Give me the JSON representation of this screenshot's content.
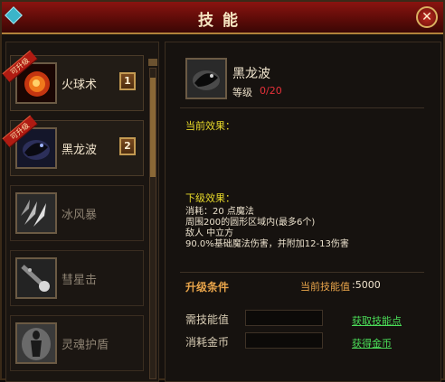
{
  "window": {
    "title": "技能"
  },
  "skills": [
    {
      "name": "火球术",
      "level": "1",
      "ribbon": "可升级"
    },
    {
      "name": "黑龙波",
      "level": "2",
      "ribbon": "可升级"
    },
    {
      "name": "冰风暴"
    },
    {
      "name": "彗星击"
    },
    {
      "name": "灵魂护盾"
    }
  ],
  "detail": {
    "name": "黑龙波",
    "level_label": "等级",
    "level_value": "0/20",
    "current_effect_title": "当前效果：",
    "next_effect_title": "下级效果：",
    "next_effect_lines": [
      "消耗：20 点魔法",
      "周围200的圆形区域内(最多6个)",
      "敌人 中立方",
      "90.0%基础魔法伤害，并附加12-13伤害"
    ],
    "upgrade_title": "升级条件",
    "current_points_label": "当前技能值",
    "current_points_value": ":5000",
    "required_points_label": "需技能值",
    "gold_cost_label": "消耗金币",
    "get_points_link": "获取技能点",
    "get_gold_link": "获得金币"
  },
  "colors": {
    "title_bar": "#7a120e",
    "effect_title": "#e8da2a",
    "level_value": "#e8313a",
    "upgrade_title": "#e8a44a",
    "link": "#4bdd58"
  },
  "icons": [
    "fireball-icon",
    "black-dragon-wave-icon",
    "ice-storm-icon",
    "comet-strike-icon",
    "soul-shield-icon",
    "close-icon"
  ]
}
